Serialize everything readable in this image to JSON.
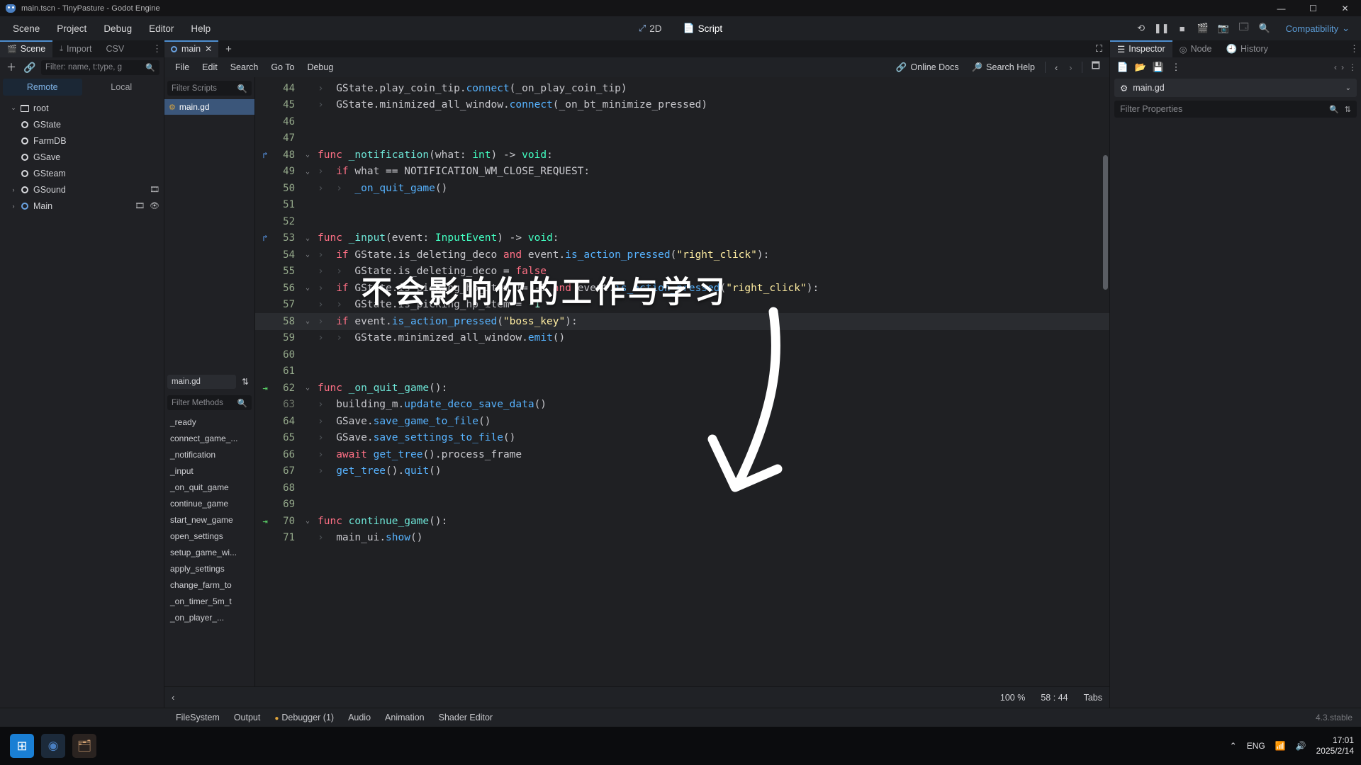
{
  "window": {
    "title": "main.tscn - TinyPasture - Godot Engine",
    "minimize": "—",
    "maximize": "☐",
    "close": "✕"
  },
  "menubar": {
    "items": [
      "Scene",
      "Project",
      "Debug",
      "Editor",
      "Help"
    ]
  },
  "modes": {
    "d2": "2D",
    "script": "Script"
  },
  "toolbar_right": {
    "icons": [
      "reload-icon",
      "pause-icon",
      "stop-icon",
      "movie-icon",
      "camera-icon",
      "layout-icon",
      "distraction-free-icon"
    ],
    "renderer": "Compatibility",
    "renderer_chevron": "⌄"
  },
  "scene_dock": {
    "tabs": [
      {
        "label": "Scene",
        "icon": "scene-icon",
        "active": true
      },
      {
        "label": "Import",
        "icon": "import-icon",
        "active": false
      },
      {
        "label": "CSV",
        "icon": "csv-icon",
        "active": false
      }
    ],
    "kebab": "⋮",
    "add_icon": "plus-icon",
    "link_icon": "link-icon",
    "filter_placeholder": "Filter: name, t:type, g",
    "search_icon": "search-icon",
    "remote": "Remote",
    "local": "Local",
    "tree": [
      {
        "label": "root",
        "icon": "scene-root-icon",
        "depth": 0,
        "caret": "⌄",
        "selected": false
      },
      {
        "label": "GState",
        "icon": "node-icon",
        "depth": 1,
        "caret": "",
        "selected": false
      },
      {
        "label": "FarmDB",
        "icon": "node-icon",
        "depth": 1,
        "caret": "",
        "selected": false
      },
      {
        "label": "GSave",
        "icon": "node-icon",
        "depth": 1,
        "caret": "",
        "selected": false
      },
      {
        "label": "GSteam",
        "icon": "node-icon",
        "depth": 1,
        "caret": "",
        "selected": false
      },
      {
        "label": "GSound",
        "icon": "node-icon",
        "depth": 1,
        "caret": "›",
        "badges": [
          "script-icon"
        ],
        "selected": false
      },
      {
        "label": "Main",
        "icon": "node-icon-blue",
        "depth": 1,
        "caret": "›",
        "badges": [
          "script-icon",
          "eye-icon"
        ],
        "selected": true
      }
    ]
  },
  "script_editor": {
    "tab": {
      "label": "main",
      "close": "✕",
      "icon": "script-tab-icon"
    },
    "new_tab": "+",
    "expand_icon": "expand-icon",
    "menus": [
      "File",
      "Edit",
      "Search",
      "Go To",
      "Debug"
    ],
    "online_docs": "Online Docs",
    "search_help": "Search Help",
    "nav_prev": "‹",
    "nav_next": "›",
    "panel_toggle_icon": "panel-toggle-icon",
    "filter_scripts_placeholder": "Filter Scripts",
    "script_list": [
      {
        "label": "main.gd",
        "icon": "gd-script-icon",
        "active": true
      }
    ],
    "member_file": "main.gd",
    "sort_icon": "sort-icon",
    "filter_methods_placeholder": "Filter Methods",
    "methods": [
      "_ready",
      "connect_game_...",
      "_notification",
      "_input",
      "_on_quit_game",
      "continue_game",
      "start_new_game",
      "open_settings",
      "setup_game_wi...",
      "apply_settings",
      "change_farm_to",
      "_on_timer_5m_t",
      "_on_player_..."
    ],
    "status": {
      "zoom": "100 %",
      "line_col": "58 : 44",
      "indent": "Tabs",
      "prev_icon": "‹"
    }
  },
  "code": {
    "lines": [
      {
        "num": "44",
        "gutter": "",
        "fold": "",
        "indent": 1,
        "tokens": [
          {
            "t": "GState",
            "c": "id"
          },
          {
            "t": ".",
            "c": "dot"
          },
          {
            "t": "play_coin_tip",
            "c": "id"
          },
          {
            "t": ".",
            "c": "dot"
          },
          {
            "t": "connect",
            "c": "fn"
          },
          {
            "t": "(",
            "c": "punc"
          },
          {
            "t": "_on_play_coin_tip",
            "c": "id"
          },
          {
            "t": ")",
            "c": "punc"
          }
        ]
      },
      {
        "num": "45",
        "gutter": "",
        "fold": "",
        "indent": 1,
        "tokens": [
          {
            "t": "GState",
            "c": "id"
          },
          {
            "t": ".",
            "c": "dot"
          },
          {
            "t": "minimized_all_window",
            "c": "id"
          },
          {
            "t": ".",
            "c": "dot"
          },
          {
            "t": "connect",
            "c": "fn"
          },
          {
            "t": "(",
            "c": "punc"
          },
          {
            "t": "_on_bt_minimize_pressed",
            "c": "id"
          },
          {
            "t": ")",
            "c": "punc"
          }
        ]
      },
      {
        "num": "46",
        "gutter": "",
        "fold": "",
        "indent": 0,
        "tokens": []
      },
      {
        "num": "47",
        "gutter": "",
        "fold": "",
        "indent": 0,
        "tokens": []
      },
      {
        "num": "48",
        "gutter": "signal-icon",
        "fold": "⌄",
        "indent": 0,
        "tokens": [
          {
            "t": "func",
            "c": "kw"
          },
          {
            "t": " ",
            "c": "punc"
          },
          {
            "t": "_notification",
            "c": "fname"
          },
          {
            "t": "(",
            "c": "punc"
          },
          {
            "t": "what",
            "c": "id"
          },
          {
            "t": ": ",
            "c": "punc"
          },
          {
            "t": "int",
            "c": "typ"
          },
          {
            "t": ") -> ",
            "c": "punc"
          },
          {
            "t": "void",
            "c": "typ"
          },
          {
            "t": ":",
            "c": "punc"
          }
        ]
      },
      {
        "num": "49",
        "gutter": "",
        "fold": "⌄",
        "indent": 1,
        "tokens": [
          {
            "t": "if",
            "c": "kw"
          },
          {
            "t": " what == NOTIFICATION_WM_CLOSE_REQUEST:",
            "c": "id"
          }
        ]
      },
      {
        "num": "50",
        "gutter": "",
        "fold": "",
        "indent": 2,
        "tokens": [
          {
            "t": "_on_quit_game",
            "c": "fn"
          },
          {
            "t": "()",
            "c": "punc"
          }
        ]
      },
      {
        "num": "51",
        "gutter": "",
        "fold": "",
        "indent": 0,
        "tokens": []
      },
      {
        "num": "52",
        "gutter": "",
        "fold": "",
        "indent": 0,
        "tokens": []
      },
      {
        "num": "53",
        "gutter": "signal-icon",
        "fold": "⌄",
        "indent": 0,
        "tokens": [
          {
            "t": "func",
            "c": "kw"
          },
          {
            "t": " ",
            "c": "punc"
          },
          {
            "t": "_input",
            "c": "fname"
          },
          {
            "t": "(",
            "c": "punc"
          },
          {
            "t": "event",
            "c": "id"
          },
          {
            "t": ": ",
            "c": "punc"
          },
          {
            "t": "InputEvent",
            "c": "typ"
          },
          {
            "t": ") -> ",
            "c": "punc"
          },
          {
            "t": "void",
            "c": "typ"
          },
          {
            "t": ":",
            "c": "punc"
          }
        ]
      },
      {
        "num": "54",
        "gutter": "",
        "fold": "⌄",
        "indent": 1,
        "tokens": [
          {
            "t": "if",
            "c": "kw"
          },
          {
            "t": " GState.is_deleting_deco ",
            "c": "id"
          },
          {
            "t": "and",
            "c": "kw"
          },
          {
            "t": " event.",
            "c": "id"
          },
          {
            "t": "is_action_pressed",
            "c": "fn"
          },
          {
            "t": "(",
            "c": "punc"
          },
          {
            "t": "\"right_click\"",
            "c": "str"
          },
          {
            "t": "):",
            "c": "punc"
          }
        ]
      },
      {
        "num": "55",
        "gutter": "",
        "fold": "",
        "indent": 2,
        "tokens": [
          {
            "t": "GState.is_deleting_deco = ",
            "c": "id"
          },
          {
            "t": "false",
            "c": "kw"
          }
        ]
      },
      {
        "num": "56",
        "gutter": "",
        "fold": "⌄",
        "indent": 1,
        "tokens": [
          {
            "t": "if",
            "c": "kw"
          },
          {
            "t": " GState.is_picking_hp_item != -1 ",
            "c": "id"
          },
          {
            "t": "and",
            "c": "kw"
          },
          {
            "t": " event.",
            "c": "id"
          },
          {
            "t": "is_action_pressed",
            "c": "fn"
          },
          {
            "t": "(",
            "c": "punc"
          },
          {
            "t": "\"right_click\"",
            "c": "str"
          },
          {
            "t": "):",
            "c": "punc"
          }
        ]
      },
      {
        "num": "57",
        "gutter": "",
        "fold": "",
        "indent": 2,
        "tokens": [
          {
            "t": "GState.is_picking_hp_item = ",
            "c": "id"
          },
          {
            "t": "-1",
            "c": "num"
          }
        ]
      },
      {
        "num": "58",
        "gutter": "",
        "fold": "⌄",
        "indent": 1,
        "highlight": true,
        "tokens": [
          {
            "t": "if",
            "c": "kw"
          },
          {
            "t": " event.",
            "c": "id"
          },
          {
            "t": "is_action_pressed",
            "c": "fn"
          },
          {
            "t": "(",
            "c": "punc"
          },
          {
            "t": "\"boss_key\"",
            "c": "str"
          },
          {
            "t": "):",
            "c": "punc"
          }
        ]
      },
      {
        "num": "59",
        "gutter": "",
        "fold": "",
        "indent": 2,
        "tokens": [
          {
            "t": "GState",
            "c": "id"
          },
          {
            "t": ".",
            "c": "dot"
          },
          {
            "t": "minimized_all_window",
            "c": "id"
          },
          {
            "t": ".",
            "c": "dot"
          },
          {
            "t": "emit",
            "c": "fn"
          },
          {
            "t": "()",
            "c": "punc"
          }
        ]
      },
      {
        "num": "60",
        "gutter": "",
        "fold": "",
        "indent": 0,
        "tokens": []
      },
      {
        "num": "61",
        "gutter": "",
        "fold": "",
        "indent": 0,
        "tokens": []
      },
      {
        "num": "62",
        "gutter": "override-icon",
        "fold": "⌄",
        "indent": 0,
        "tokens": [
          {
            "t": "func",
            "c": "kw"
          },
          {
            "t": " ",
            "c": "punc"
          },
          {
            "t": "_on_quit_game",
            "c": "fname"
          },
          {
            "t": "():",
            "c": "punc"
          }
        ]
      },
      {
        "num": "63",
        "gutter": "",
        "fold": "",
        "indent": 1,
        "dimnum": true,
        "tokens": [
          {
            "t": "building_m",
            "c": "id"
          },
          {
            "t": ".",
            "c": "dot"
          },
          {
            "t": "update_deco_save_data",
            "c": "fn"
          },
          {
            "t": "()",
            "c": "punc"
          }
        ]
      },
      {
        "num": "64",
        "gutter": "",
        "fold": "",
        "indent": 1,
        "tokens": [
          {
            "t": "GSave",
            "c": "id"
          },
          {
            "t": ".",
            "c": "dot"
          },
          {
            "t": "save_game_to_file",
            "c": "fn"
          },
          {
            "t": "()",
            "c": "punc"
          }
        ]
      },
      {
        "num": "65",
        "gutter": "",
        "fold": "",
        "indent": 1,
        "tokens": [
          {
            "t": "GSave",
            "c": "id"
          },
          {
            "t": ".",
            "c": "dot"
          },
          {
            "t": "save_settings_to_file",
            "c": "fn"
          },
          {
            "t": "()",
            "c": "punc"
          }
        ]
      },
      {
        "num": "66",
        "gutter": "",
        "fold": "",
        "indent": 1,
        "tokens": [
          {
            "t": "await",
            "c": "kw"
          },
          {
            "t": " ",
            "c": "punc"
          },
          {
            "t": "get_tree",
            "c": "fn"
          },
          {
            "t": "()",
            "c": "punc"
          },
          {
            "t": ".",
            "c": "dot"
          },
          {
            "t": "process_frame",
            "c": "id"
          }
        ]
      },
      {
        "num": "67",
        "gutter": "",
        "fold": "",
        "indent": 1,
        "tokens": [
          {
            "t": "get_tree",
            "c": "fn"
          },
          {
            "t": "()",
            "c": "punc"
          },
          {
            "t": ".",
            "c": "dot"
          },
          {
            "t": "quit",
            "c": "fn"
          },
          {
            "t": "()",
            "c": "punc"
          }
        ]
      },
      {
        "num": "68",
        "gutter": "",
        "fold": "",
        "indent": 0,
        "tokens": []
      },
      {
        "num": "69",
        "gutter": "",
        "fold": "",
        "indent": 0,
        "tokens": []
      },
      {
        "num": "70",
        "gutter": "override-icon",
        "fold": "⌄",
        "indent": 0,
        "tokens": [
          {
            "t": "func",
            "c": "kw"
          },
          {
            "t": " ",
            "c": "punc"
          },
          {
            "t": "continue_game",
            "c": "fname"
          },
          {
            "t": "():",
            "c": "punc"
          }
        ]
      },
      {
        "num": "71",
        "gutter": "",
        "fold": "",
        "indent": 1,
        "tokens": [
          {
            "t": "main_ui",
            "c": "id"
          },
          {
            "t": ".",
            "c": "dot"
          },
          {
            "t": "show",
            "c": "fn"
          },
          {
            "t": "()",
            "c": "punc"
          }
        ]
      }
    ]
  },
  "inspector": {
    "tabs": [
      {
        "label": "Inspector",
        "icon": "inspector-icon",
        "active": true
      },
      {
        "label": "Node",
        "icon": "node-tab-icon",
        "active": false
      },
      {
        "label": "History",
        "icon": "history-icon",
        "active": false
      }
    ],
    "kebab": "⋮",
    "tools": [
      "new-resource-icon",
      "open-resource-icon",
      "save-resource-icon",
      "more-icon"
    ],
    "nav_prev": "‹",
    "nav_next": "›",
    "object_name": "main.gd",
    "object_icon": "gear-icon",
    "object_chevron": "⌄",
    "filter_placeholder": "Filter Properties",
    "filter_search_icon": "search-icon",
    "filter_options_icon": "filter-options-icon"
  },
  "bottom_panel": {
    "items": [
      {
        "label": "FileSystem",
        "icon": ""
      },
      {
        "label": "Output",
        "icon": ""
      },
      {
        "label": "Debugger (1)",
        "icon": "warning-dot"
      },
      {
        "label": "Audio",
        "icon": ""
      },
      {
        "label": "Animation",
        "icon": ""
      },
      {
        "label": "Shader Editor",
        "icon": ""
      }
    ],
    "version": "4.3.stable"
  },
  "overlay": {
    "watermark": "不会影响你的工作与学习",
    "arrow": "curved-down-arrow"
  },
  "taskbar": {
    "apps": [
      {
        "name": "start-button",
        "glyph": "⊞"
      },
      {
        "name": "godot-taskbar-icon",
        "glyph": "◉"
      },
      {
        "name": "file-explorer-icon",
        "glyph": "◫"
      }
    ],
    "tray": {
      "chevron": "⌃",
      "ime": "ENG",
      "wifi_icon": "wifi-icon",
      "volume_icon": "volume-icon",
      "time": "17:01",
      "date": "2025/2/14"
    }
  },
  "colors": {
    "accent": "#4f8fd0",
    "editor_bg": "#1f2023",
    "panel_bg": "#202125",
    "keyword": "#ff7085",
    "function": "#57b3ff",
    "type": "#42ffc2",
    "string": "#ffeda1"
  }
}
